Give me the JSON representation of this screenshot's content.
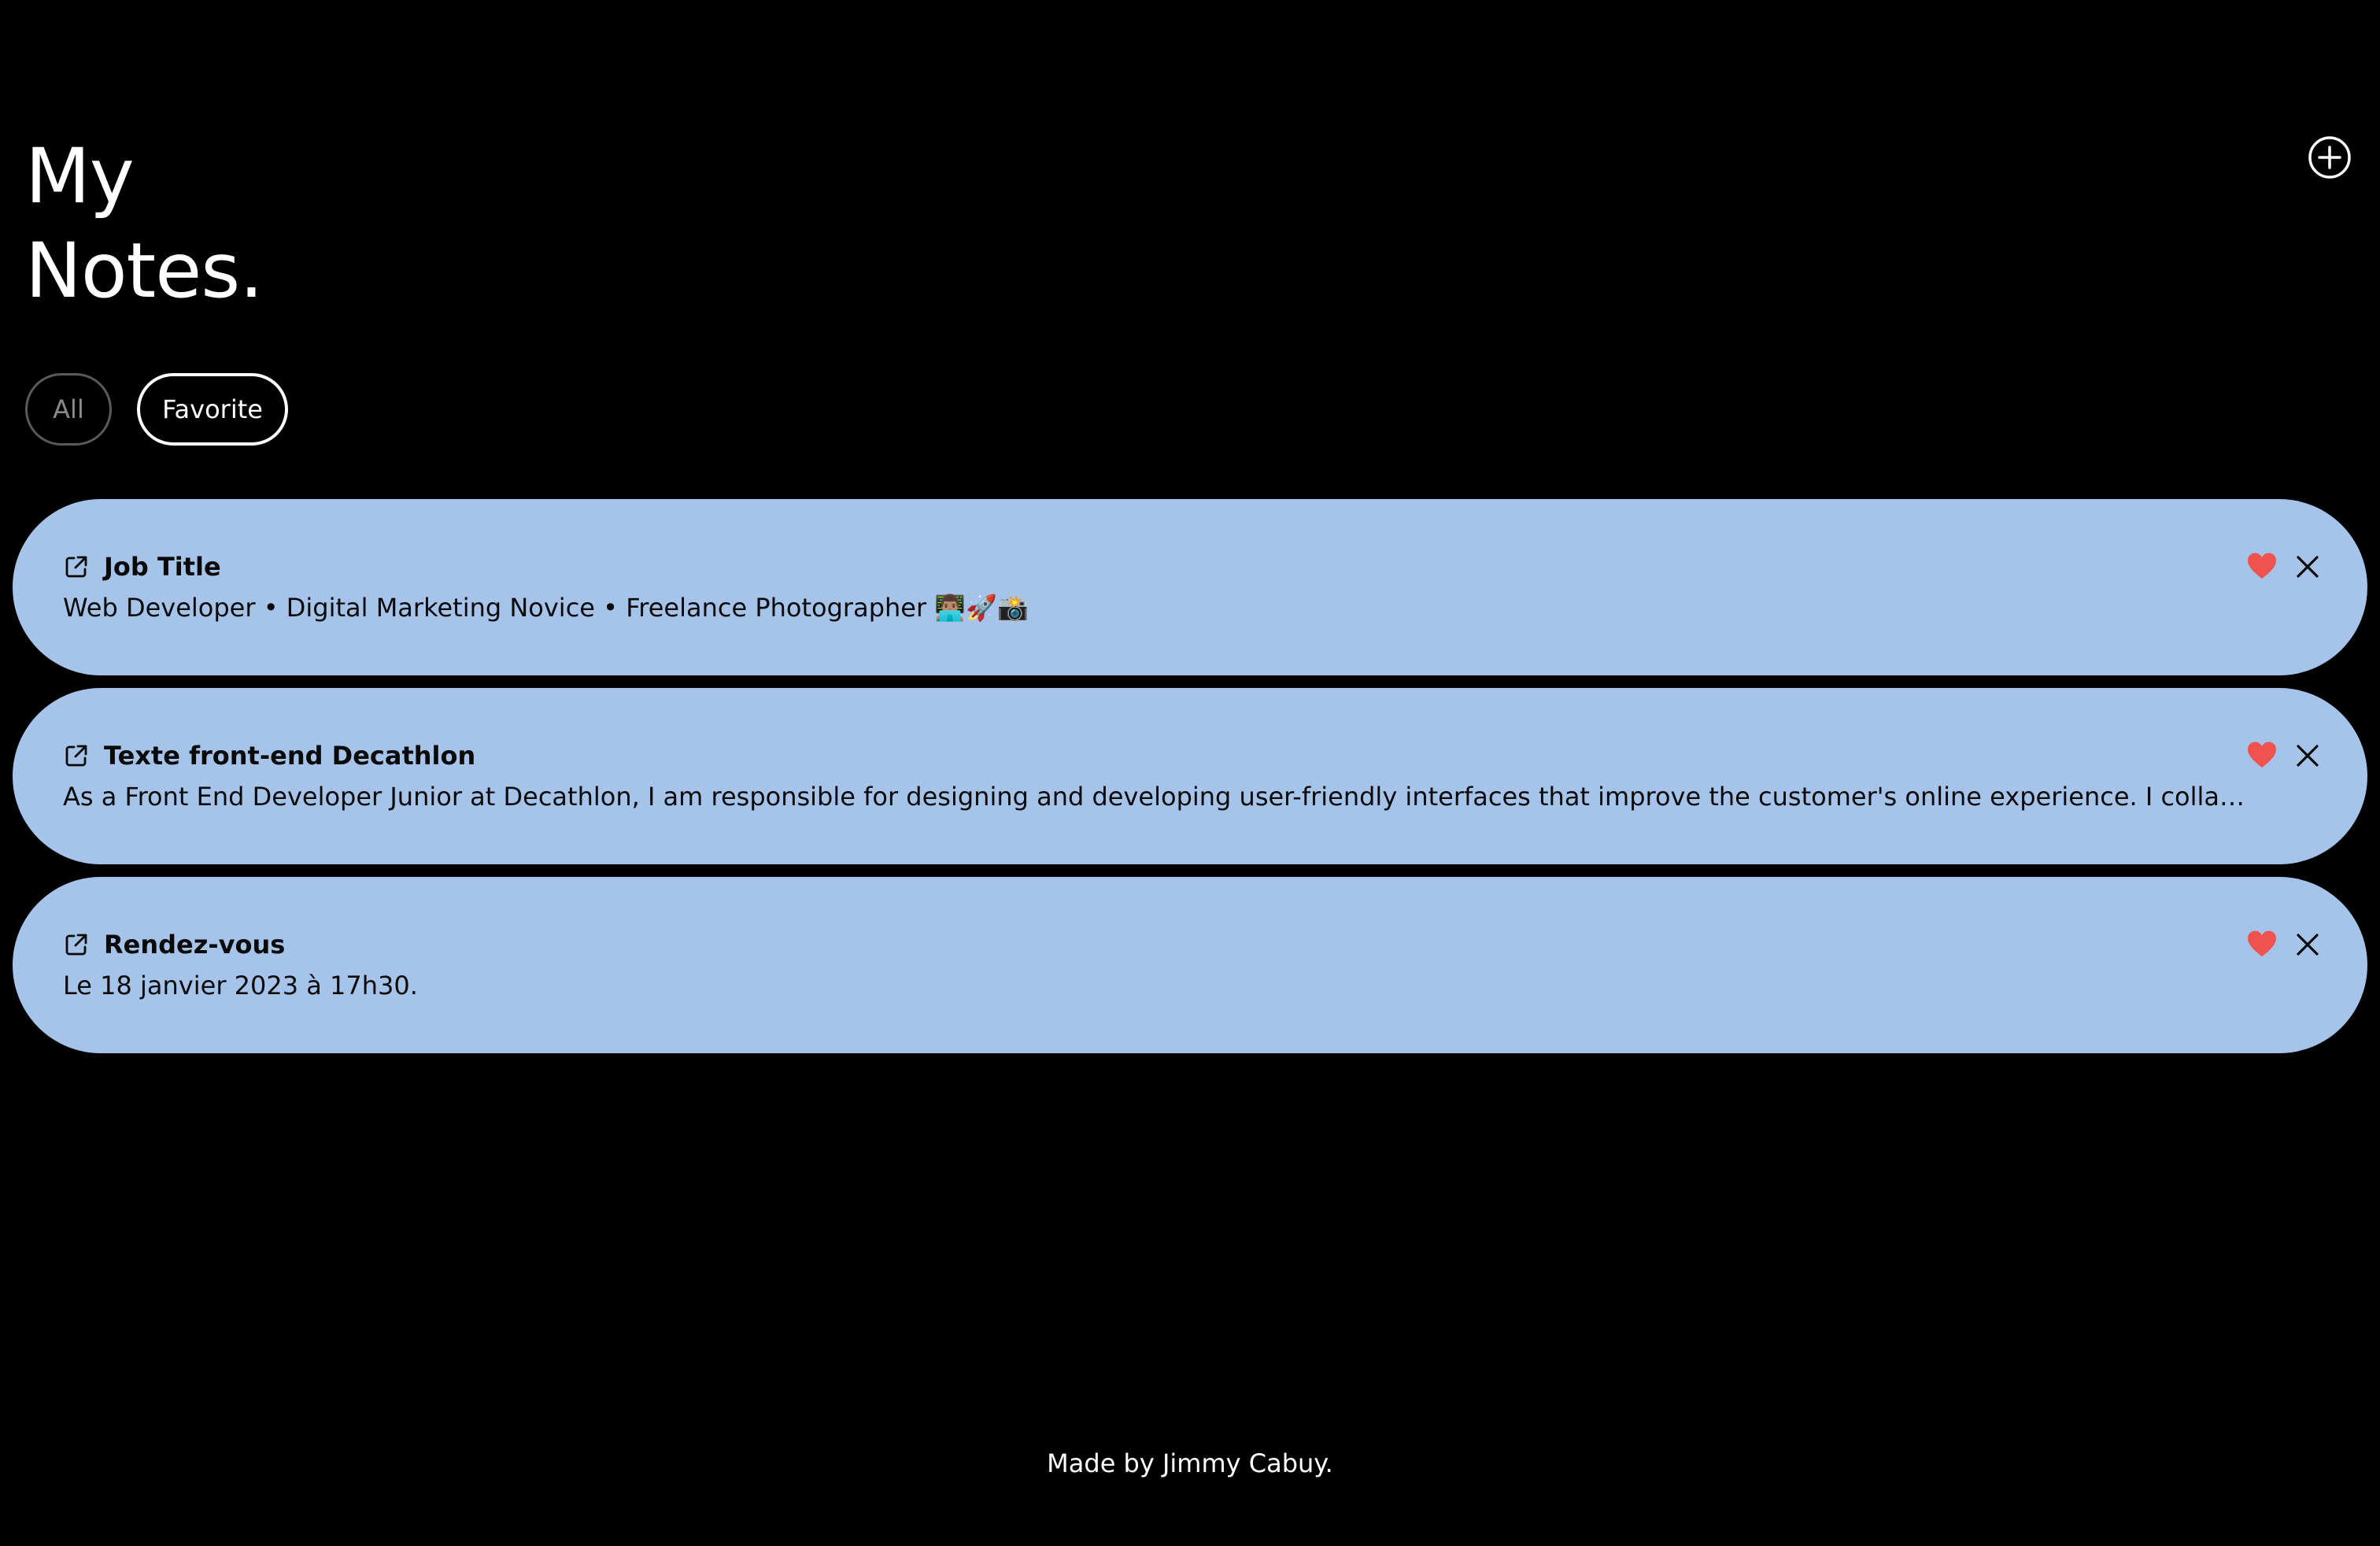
{
  "header": {
    "title_line1": "My",
    "title_line2": "Notes."
  },
  "filters": {
    "all_label": "All",
    "favorite_label": "Favorite",
    "active": "Favorite"
  },
  "notes": [
    {
      "title": "Job Title",
      "body": "Web Developer • Digital Marketing Novice • Freelance Photographer 👨🏽‍💻🚀📸",
      "favorite": true
    },
    {
      "title": "Texte front-end Decathlon",
      "body": "As a Front End Developer Junior at Decathlon, I am responsible for designing and developing user-friendly interfaces that improve the customer's online experience. I collaborate with the...",
      "favorite": true
    },
    {
      "title": "Rendez-vous",
      "body": "Le 18 janvier 2023 à 17h30.",
      "favorite": true
    }
  ],
  "footer": {
    "text": "Made by Jimmy Cabuy."
  },
  "icons": {
    "add": "plus-circle-icon",
    "open": "external-link-icon",
    "favorite": "heart-icon",
    "delete": "close-icon"
  },
  "colors": {
    "background": "#000000",
    "card": "#a6c4ea",
    "heart": "#ef5350",
    "text": "#ffffff"
  }
}
